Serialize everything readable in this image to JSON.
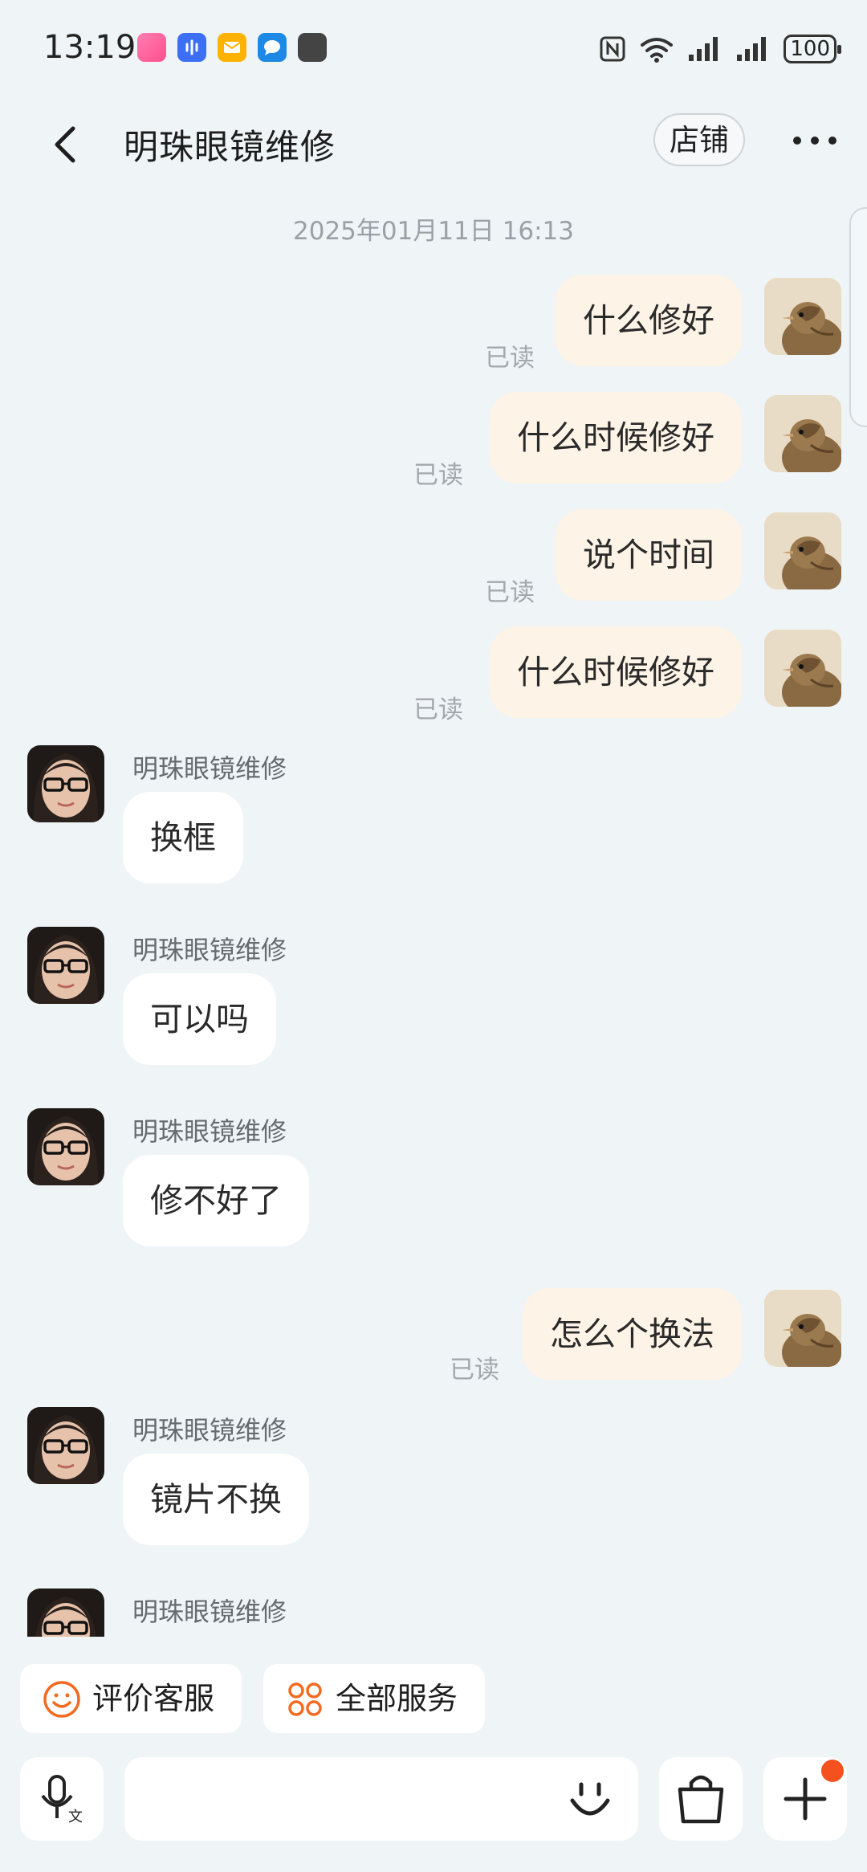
{
  "status_bar": {
    "time": "13:19",
    "battery": "100"
  },
  "header": {
    "title": "明珠眼镜维修",
    "shop_button": "店铺"
  },
  "chat": {
    "timestamp": "2025年01月11日 16:13",
    "read_label": "已读",
    "merchant_name": "明珠眼镜维修",
    "messages": [
      {
        "from": "me",
        "text": "什么修好"
      },
      {
        "from": "me",
        "text": "什么时候修好"
      },
      {
        "from": "me",
        "text": "说个时间"
      },
      {
        "from": "me",
        "text": "什么时候修好"
      },
      {
        "from": "merchant",
        "text": "换框"
      },
      {
        "from": "merchant",
        "text": "可以吗"
      },
      {
        "from": "merchant",
        "text": "修不好了"
      },
      {
        "from": "me",
        "text": "怎么个换法"
      },
      {
        "from": "merchant",
        "text": "镜片不换"
      },
      {
        "from": "merchant",
        "text": ""
      }
    ]
  },
  "quick_actions": [
    {
      "label": "评价客服",
      "icon": "smiley-icon"
    },
    {
      "label": "全部服务",
      "icon": "four-circles-icon"
    }
  ],
  "input_bar": {
    "voice_icon": "voice-translate-icon",
    "emoji_icon": "emoji-icon",
    "bag_icon": "shopping-bag-icon",
    "plus_icon": "plus-icon"
  },
  "colors": {
    "background": "#eff4f7",
    "my_bubble": "#fdf3e6",
    "their_bubble": "#ffffff",
    "accent": "#f4511e"
  }
}
